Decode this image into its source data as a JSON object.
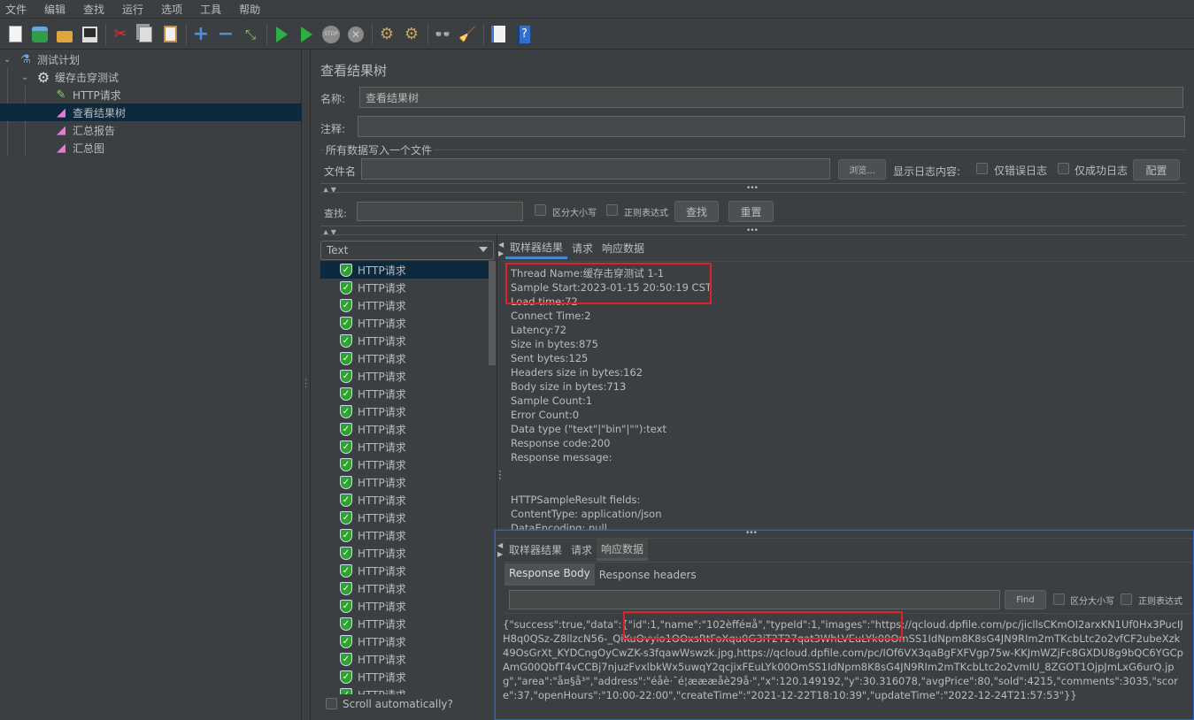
{
  "menubar": [
    "文件",
    "编辑",
    "查找",
    "运行",
    "选项",
    "工具",
    "帮助"
  ],
  "toolbar": [
    "new-icon",
    "templates-icon",
    "open-icon",
    "save-icon",
    "cut-icon",
    "copy-icon",
    "paste-icon",
    "expand-icon",
    "collapse-icon",
    "toggle-icon",
    "start-icon",
    "start-no-pause-icon",
    "stop-icon",
    "shutdown-icon",
    "clear-icon",
    "clear-all-icon",
    "search-icon",
    "reset-search-icon",
    "function-helper-icon",
    "help-icon"
  ],
  "tree": {
    "items": [
      {
        "label": "测试计划",
        "icon": "flask-icon"
      },
      {
        "label": "缓存击穿测试",
        "icon": "gear-icon"
      },
      {
        "label": "HTTP请求",
        "icon": "pipette-icon"
      },
      {
        "label": "查看结果树",
        "icon": "listener-icon",
        "selected": true
      },
      {
        "label": "汇总报告",
        "icon": "listener-icon"
      },
      {
        "label": "汇总图",
        "icon": "listener-icon"
      }
    ]
  },
  "panel": {
    "title": "查看结果树",
    "name_label": "名称:",
    "name_value": "查看结果树",
    "comment_label": "注释:",
    "comment_value": "",
    "file_group_label": "所有数据写入一个文件",
    "filename_label": "文件名",
    "filename_value": "",
    "browse_label": "浏览...",
    "log_label": "显示日志内容:",
    "errors_only_label": "仅错误日志",
    "success_only_label": "仅成功日志",
    "configure_label": "配置",
    "search_label": "查找:",
    "search_value": "",
    "case_sensitive_label": "区分大小写",
    "regex_label": "正则表达式",
    "find_label": "查找",
    "reset_label": "重置"
  },
  "renderer": {
    "selected": "Text"
  },
  "results": {
    "item_label": "HTTP请求",
    "count": 25,
    "scroll_auto_label": "Scroll automatically?"
  },
  "tabs": [
    "取样器结果",
    "请求",
    "响应数据"
  ],
  "sampler_result": [
    "Thread Name:缓存击穿测试 1-1",
    "Sample Start:2023-01-15 20:50:19 CST",
    "Load time:72",
    "Connect Time:2",
    "Latency:72",
    "Size in bytes:875",
    "Sent bytes:125",
    "Headers size in bytes:162",
    "Body size in bytes:713",
    "Sample Count:1",
    "Error Count:0",
    "Data type (\"text\"|\"bin\"|\"\"):text",
    "Response code:200",
    "Response message:",
    "",
    "",
    "HTTPSampleResult fields:",
    "ContentType: application/json",
    "DataEncoding: null"
  ],
  "response": {
    "subtabs": [
      "Response Body",
      "Response headers"
    ],
    "search_value": "",
    "find_label": "Find",
    "case_label": "区分大小写",
    "regex_label": "正则表达式",
    "body": "{\"success\":true,\"data\":{\"id\":1,\"name\":\"102èffé¤å\",\"typeId\":1,\"images\":\"https://qcloud.dpfile.com/pc/jicllsCKmOI2arxKN1Uf0Hx3PucIJH8q0QSz-Z8llzcN56-_QiKuOvyio1OOxsRtFoXqu0G3iT2T27qat3WhLVEuLYk00OmSS1IdNpm8K8sG4JN9RIm2mTKcbLtc2o2vfCF2ubeXzk49OsGrXt_KYDCngOyCwZK-s3fqawWswzk.jpg,https://qcloud.dpfile.com/pc/IOf6VX3qaBgFXFVgp75w-KKJmWZjFc8GXDU8g9bQC6YGCpAmG00QbfT4vCCBj7njuzFvxlbkWx5uwqY2qcjixFEuLYk00OmSS1IdNpm8K8sG4JN9RIm2mTKcbLtc2o2vmIU_8ZGOT1OjpJmLxG6urQ.jpg\",\"area\":\"å¤§å³\",\"address\":\"éåè·¯é¦æææåè29å·\",\"x\":120.149192,\"y\":30.316078,\"avgPrice\":80,\"sold\":4215,\"comments\":3035,\"score\":37,\"openHours\":\"10:00-22:00\",\"createTime\":\"2021-12-22T18:10:39\",\"updateTime\":\"2022-12-24T21:57:53\"}}"
  }
}
